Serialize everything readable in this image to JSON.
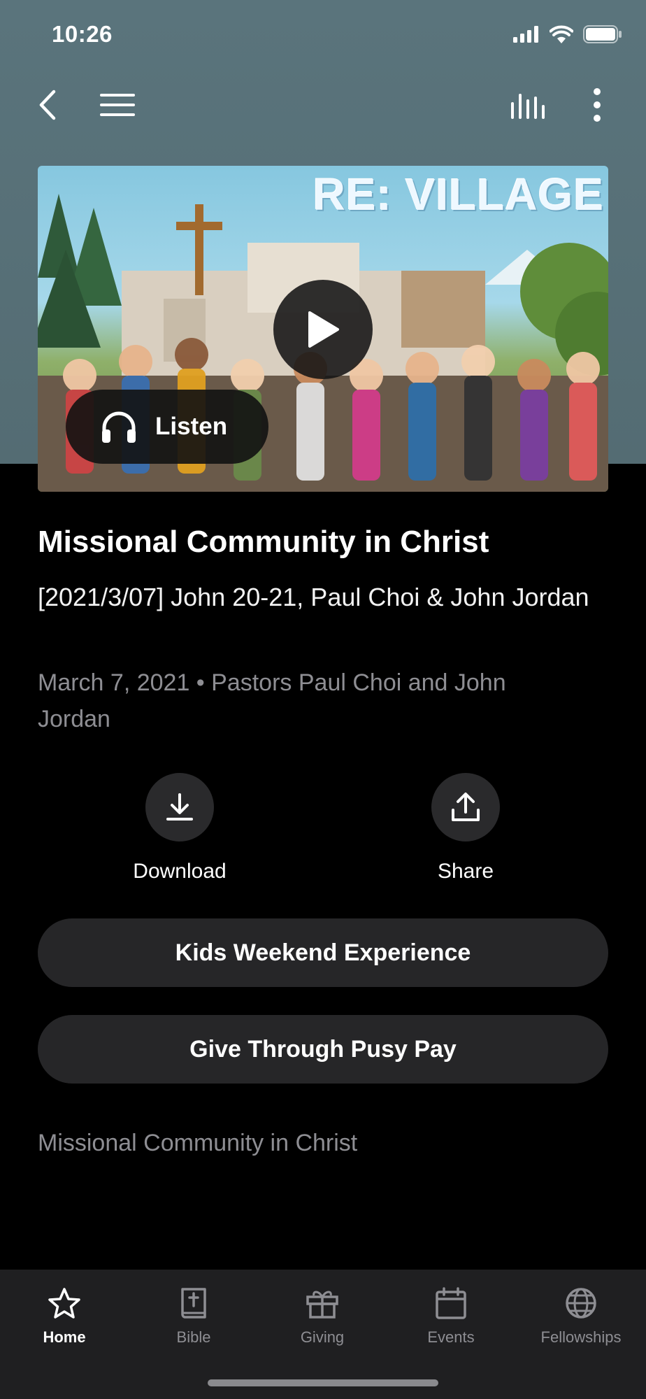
{
  "status_bar": {
    "time": "10:26"
  },
  "nav": {
    "back_icon": "chevron-left-icon",
    "menu_icon": "hamburger-icon",
    "audio_icon": "equalizer-icon",
    "more_icon": "more-vertical-icon"
  },
  "hero": {
    "image_text": "RE: VILLAGE",
    "listen_label": "Listen"
  },
  "sermon": {
    "title": "Missional Community in Christ",
    "subtitle": "[2021/3/07] John 20-21, Paul Choi & John Jordan",
    "meta": "March 7, 2021 • Pastors Paul Choi and John Jordan",
    "description": "Missional Community in Christ"
  },
  "actions": {
    "download_label": "Download",
    "share_label": "Share"
  },
  "buttons": {
    "kids_label": "Kids Weekend Experience",
    "give_label": "Give Through Pusy Pay"
  },
  "tabs": [
    {
      "label": "Home",
      "icon": "star-icon",
      "active": true
    },
    {
      "label": "Bible",
      "icon": "bible-icon",
      "active": false
    },
    {
      "label": "Giving",
      "icon": "gift-icon",
      "active": false
    },
    {
      "label": "Events",
      "icon": "calendar-icon",
      "active": false
    },
    {
      "label": "Fellowships",
      "icon": "globe-icon",
      "active": false
    }
  ],
  "colors": {
    "header_bg": "#5a747c",
    "background": "#000000",
    "pill_bg": "#262628",
    "tab_bar_bg": "#1f1f21",
    "muted_text": "#8e8e93"
  }
}
